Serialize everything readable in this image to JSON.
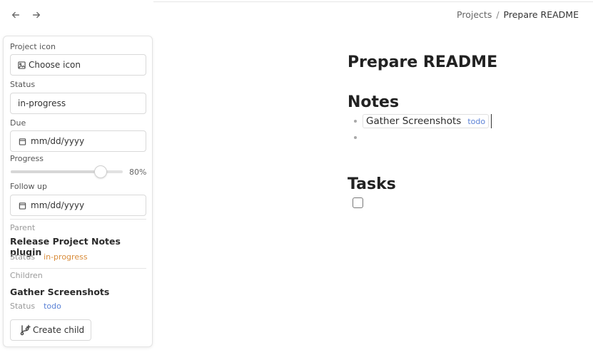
{
  "breadcrumb": {
    "root": "Projects",
    "separator": "/",
    "current": "Prepare README"
  },
  "panel": {
    "project_icon": {
      "label": "Project icon",
      "button": "Choose icon"
    },
    "status": {
      "label": "Status",
      "value": "in-progress"
    },
    "due": {
      "label": "Due",
      "placeholder": "mm/dd/yyyy"
    },
    "progress": {
      "label": "Progress",
      "value": 80,
      "display": "80%"
    },
    "follow_up": {
      "label": "Follow up",
      "placeholder": "mm/dd/yyyy"
    },
    "parent": {
      "label": "Parent",
      "title": "Release Project Notes plugin",
      "status_key": "Status",
      "status_value": "in-progress"
    },
    "children": {
      "label": "Children",
      "title": "Gather Screenshots",
      "status_key": "Status",
      "status_value": "todo"
    },
    "create_child": "Create child"
  },
  "content": {
    "title": "Prepare README",
    "notes_heading": "Notes",
    "note_item": {
      "name": "Gather Screenshots",
      "status": "todo"
    },
    "tasks_heading": "Tasks"
  },
  "colors": {
    "in_progress": "#d98c3a",
    "todo": "#5b82d6"
  },
  "icons": [
    "back-arrow-icon",
    "forward-arrow-icon",
    "image-icon",
    "calendar-icon",
    "git-branch-plus-icon"
  ]
}
